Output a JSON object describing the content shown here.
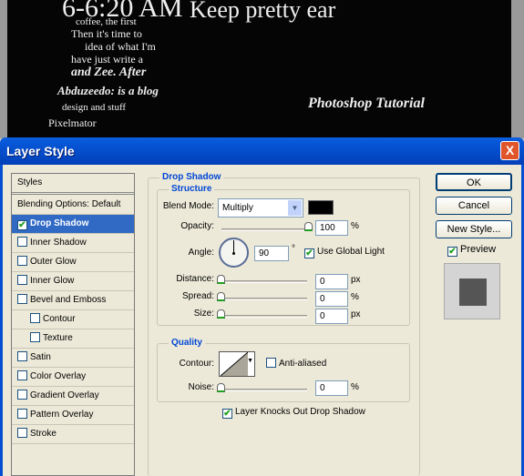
{
  "background_art": {
    "snippets": [
      "6-6:20 AM",
      "Keep pretty ear",
      "coffee, the first",
      "Then it's time to",
      "idea of what I'm",
      "have just write a",
      "and Zee. After",
      "Abduzeedo: is a blog",
      "Photoshop Tutorial",
      "design and stuff",
      "Pixelmator"
    ]
  },
  "window": {
    "title": "Layer Style",
    "close_label": "X"
  },
  "styles_list": {
    "header": "Styles",
    "items": [
      {
        "label": "Blending Options: Default",
        "checkbox": false
      },
      {
        "label": "Drop Shadow",
        "checkbox": true,
        "checked": true,
        "selected": true
      },
      {
        "label": "Inner Shadow",
        "checkbox": true,
        "checked": false
      },
      {
        "label": "Outer Glow",
        "checkbox": true,
        "checked": false
      },
      {
        "label": "Inner Glow",
        "checkbox": true,
        "checked": false
      },
      {
        "label": "Bevel and Emboss",
        "checkbox": true,
        "checked": false
      },
      {
        "label": "Contour",
        "checkbox": true,
        "checked": false,
        "indent": true
      },
      {
        "label": "Texture",
        "checkbox": true,
        "checked": false,
        "indent": true
      },
      {
        "label": "Satin",
        "checkbox": true,
        "checked": false
      },
      {
        "label": "Color Overlay",
        "checkbox": true,
        "checked": false
      },
      {
        "label": "Gradient Overlay",
        "checkbox": true,
        "checked": false
      },
      {
        "label": "Pattern Overlay",
        "checkbox": true,
        "checked": false
      },
      {
        "label": "Stroke",
        "checkbox": true,
        "checked": false
      }
    ]
  },
  "drop_shadow": {
    "title": "Drop Shadow",
    "structure": {
      "title": "Structure",
      "blend_mode_label": "Blend Mode:",
      "blend_mode": "Multiply",
      "shadow_color": "#000000",
      "opacity_label": "Opacity:",
      "opacity": "100",
      "opacity_unit": "%",
      "angle_label": "Angle:",
      "angle": "90",
      "angle_unit": "°",
      "use_global_light": "Use Global Light",
      "use_global_light_checked": true,
      "distance_label": "Distance:",
      "distance": "0",
      "distance_unit": "px",
      "spread_label": "Spread:",
      "spread": "0",
      "spread_unit": "%",
      "size_label": "Size:",
      "size": "0",
      "size_unit": "px"
    },
    "quality": {
      "title": "Quality",
      "contour_label": "Contour:",
      "anti_aliased": "Anti-aliased",
      "anti_aliased_checked": false,
      "noise_label": "Noise:",
      "noise": "0",
      "noise_unit": "%"
    },
    "knockout": "Layer Knocks Out Drop Shadow",
    "knockout_checked": true
  },
  "buttons": {
    "ok": "OK",
    "cancel": "Cancel",
    "new_style": "New Style...",
    "preview": "Preview",
    "preview_checked": true
  }
}
